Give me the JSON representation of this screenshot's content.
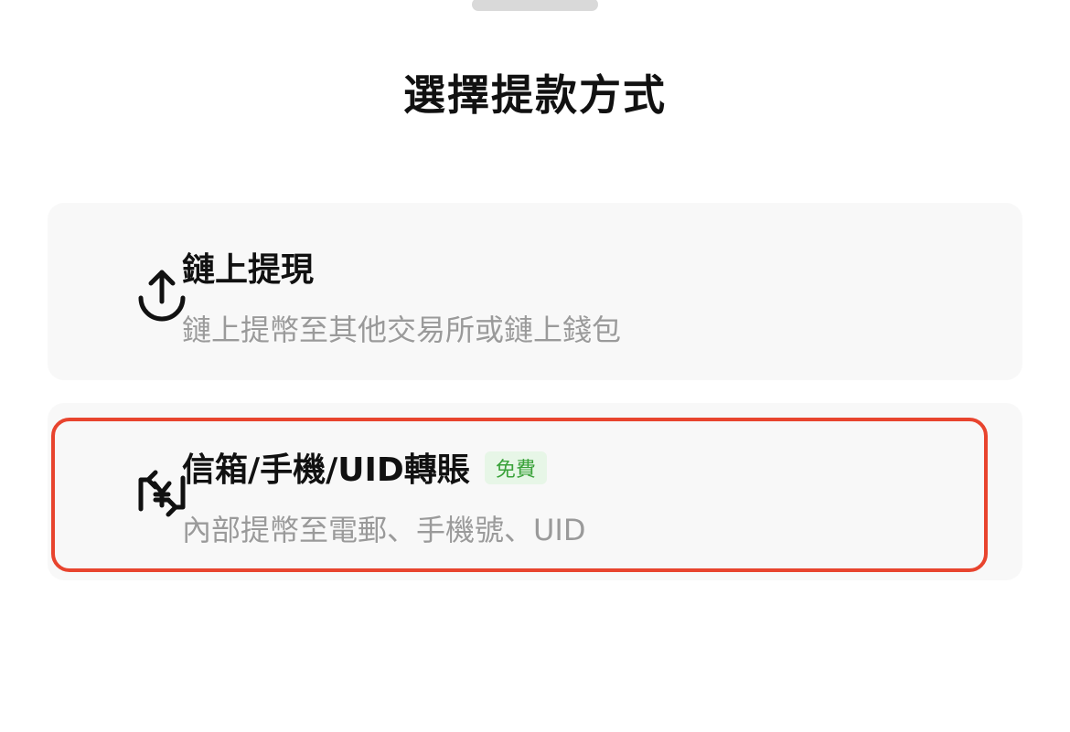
{
  "sheet": {
    "title": "選擇提款方式"
  },
  "options": [
    {
      "title": "鏈上提現",
      "subtitle": "鏈上提幣至其他交易所或鏈上錢包",
      "icon": "upload-arrow-icon"
    },
    {
      "title": "信箱/手機/UID轉賬",
      "badge": "免費",
      "subtitle": "內部提幣至電郵、手機號、UID",
      "icon": "yen-transfer-icon"
    }
  ],
  "colors": {
    "highlight_border": "#e8442e",
    "badge_bg": "#e7f6e7",
    "badge_text": "#3aa23a",
    "subtitle_text": "#9a9a9a",
    "card_bg": "#f8f8f8"
  }
}
